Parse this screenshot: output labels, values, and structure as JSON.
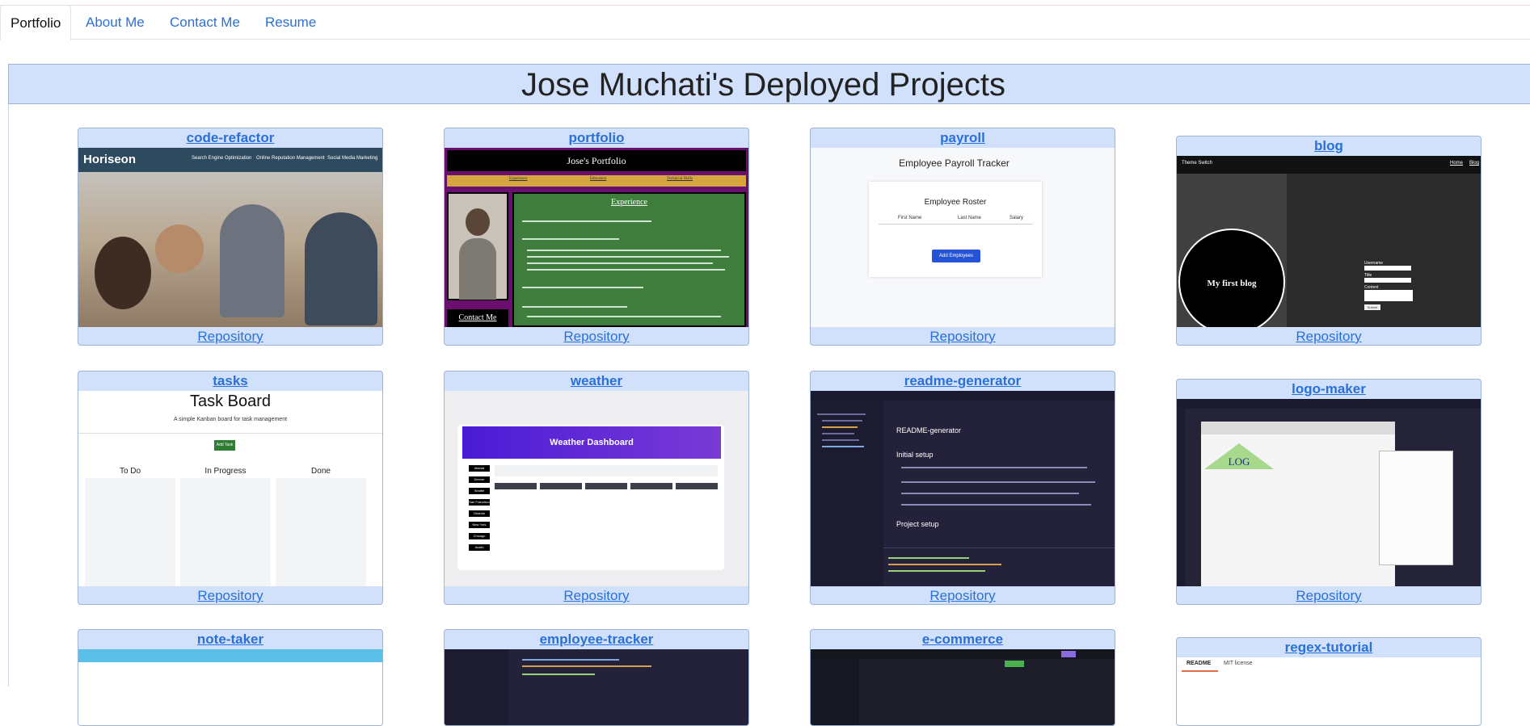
{
  "nav": {
    "tabs": [
      {
        "label": "Portfolio",
        "active": true
      },
      {
        "label": "About Me"
      },
      {
        "label": "Contact Me"
      },
      {
        "label": "Resume"
      }
    ]
  },
  "page": {
    "title": "Jose Muchati's Deployed Projects"
  },
  "repo_label": "Repository",
  "projects": [
    {
      "title": "code-refactor"
    },
    {
      "title": "portfolio"
    },
    {
      "title": "payroll"
    },
    {
      "title": "blog"
    },
    {
      "title": "tasks"
    },
    {
      "title": "weather"
    },
    {
      "title": "readme-generator"
    },
    {
      "title": "logo-maker"
    },
    {
      "title": "note-taker"
    },
    {
      "title": "employee-tracker"
    },
    {
      "title": "e-commerce"
    },
    {
      "title": "regex-tutorial"
    }
  ],
  "previews": {
    "horiseon": {
      "brand": "Horiseon",
      "links": [
        "Search Engine Optimization",
        "Online Reputation Management",
        "Social Media Marketing"
      ]
    },
    "portfolio": {
      "name": "Jose's Portfolio",
      "links": [
        "Experience",
        "Education",
        "Technical Skills"
      ],
      "heading": "Experience",
      "contact": "Contact Me"
    },
    "payroll": {
      "title": "Employee Payroll Tracker",
      "roster": "Employee Roster",
      "cols": [
        "First Name",
        "Last Name",
        "Salary"
      ],
      "button": "Add Employees"
    },
    "blog": {
      "theme": "Theme Switch",
      "links": [
        "Home",
        "Blog"
      ],
      "circle": "My first blog",
      "fields": [
        "Username",
        "Title",
        "Content"
      ],
      "submit": "Submit"
    },
    "tasks": {
      "title": "Task Board",
      "subtitle": "A simple Kanban board for task management",
      "button": "Add Task",
      "cols": [
        "To Do",
        "In Progress",
        "Done"
      ]
    },
    "weather": {
      "title": "Weather Dashboard",
      "cities": [
        "Atlanta",
        "Denver",
        "Seattle",
        "San Francisco",
        "Orlando",
        "New York",
        "Chicago",
        "Austin"
      ]
    },
    "readme": {
      "h1": "README-generator",
      "h2": "Initial setup",
      "h3": "Project setup"
    },
    "logo": {
      "text": "LOG"
    },
    "regex": {
      "tabs": [
        "README",
        "MIT license"
      ]
    }
  }
}
